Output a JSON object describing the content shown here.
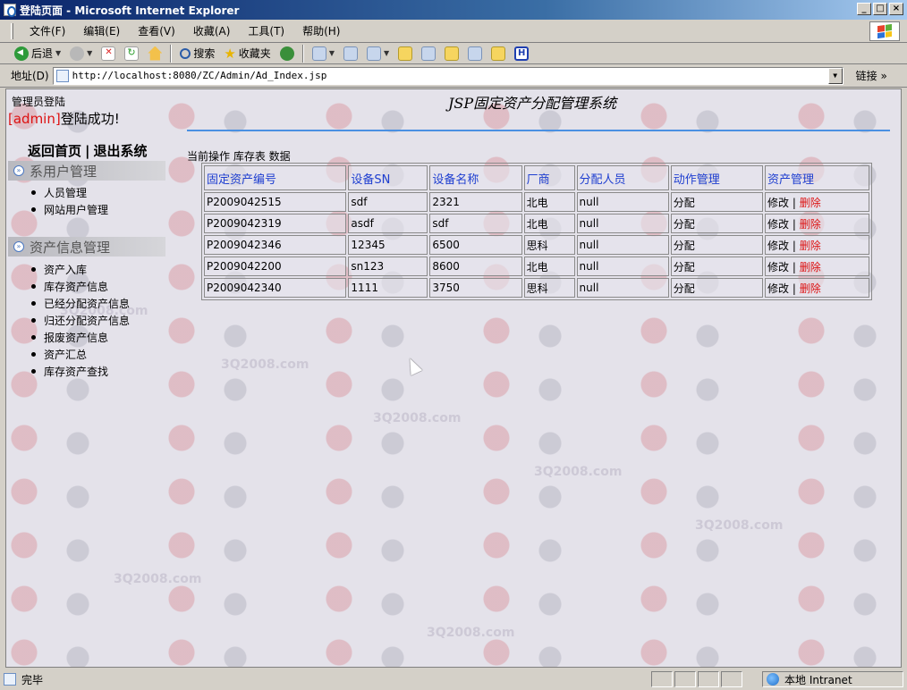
{
  "window": {
    "title": "登陆页面 - Microsoft Internet Explorer",
    "controls": [
      "_",
      "□",
      "×"
    ]
  },
  "menu": {
    "items": [
      "文件(F)",
      "编辑(E)",
      "查看(V)",
      "收藏(A)",
      "工具(T)",
      "帮助(H)"
    ]
  },
  "toolbar": {
    "back_label": "后退",
    "search_label": "搜索",
    "favorites_label": "收藏夹"
  },
  "address": {
    "label": "地址(D)",
    "url": "http://localhost:8080/ZC/Admin/Ad_Index.jsp",
    "links_label": "链接"
  },
  "page": {
    "admin_login_label": "管理员登陆",
    "login_user": "[admin]",
    "login_success": "登陆成功!",
    "site_title": "JSP固定资产分配管理系统",
    "nav_home": "返回首页",
    "nav_sep": "|",
    "nav_logout": "退出系统",
    "current_op": "当前操作 库存表 数据",
    "watermark": "3Q2008.com"
  },
  "sidebar": {
    "sections": [
      {
        "title": "系用户管理",
        "items": [
          "人员管理",
          "网站用户管理"
        ]
      },
      {
        "title": "资产信息管理",
        "items": [
          "资产入库",
          "库存资产信息",
          "已经分配资产信息",
          "归还分配资产信息",
          "报废资产信息",
          "资产汇总",
          "库存资产查找"
        ]
      }
    ]
  },
  "table": {
    "headers": [
      "固定资产编号",
      "设备SN",
      "设备名称",
      "厂商",
      "分配人员",
      "动作管理",
      "资产管理"
    ],
    "edit_label": "修改",
    "sep": "|",
    "delete_label": "删除",
    "rows": [
      {
        "id": "P2009042515",
        "sn": "sdf",
        "name": "2321",
        "vendor": "北电",
        "assignee": "null",
        "action": "分配"
      },
      {
        "id": "P2009042319",
        "sn": "asdf",
        "name": "sdf",
        "vendor": "北电",
        "assignee": "null",
        "action": "分配"
      },
      {
        "id": "P2009042346",
        "sn": "12345",
        "name": "6500",
        "vendor": "思科",
        "assignee": "null",
        "action": "分配"
      },
      {
        "id": "P2009042200",
        "sn": "sn123",
        "name": "8600",
        "vendor": "北电",
        "assignee": "null",
        "action": "分配"
      },
      {
        "id": "P2009042340",
        "sn": "1111",
        "name": "3750",
        "vendor": "思科",
        "assignee": "null",
        "action": "分配"
      }
    ]
  },
  "status": {
    "text": "完毕",
    "zone": "本地 Intranet"
  },
  "colors": {
    "title_bar": "#0a246a",
    "header_link": "#1f3fd0",
    "delete_link": "#dd1111",
    "accent_line": "#4a90e2"
  }
}
